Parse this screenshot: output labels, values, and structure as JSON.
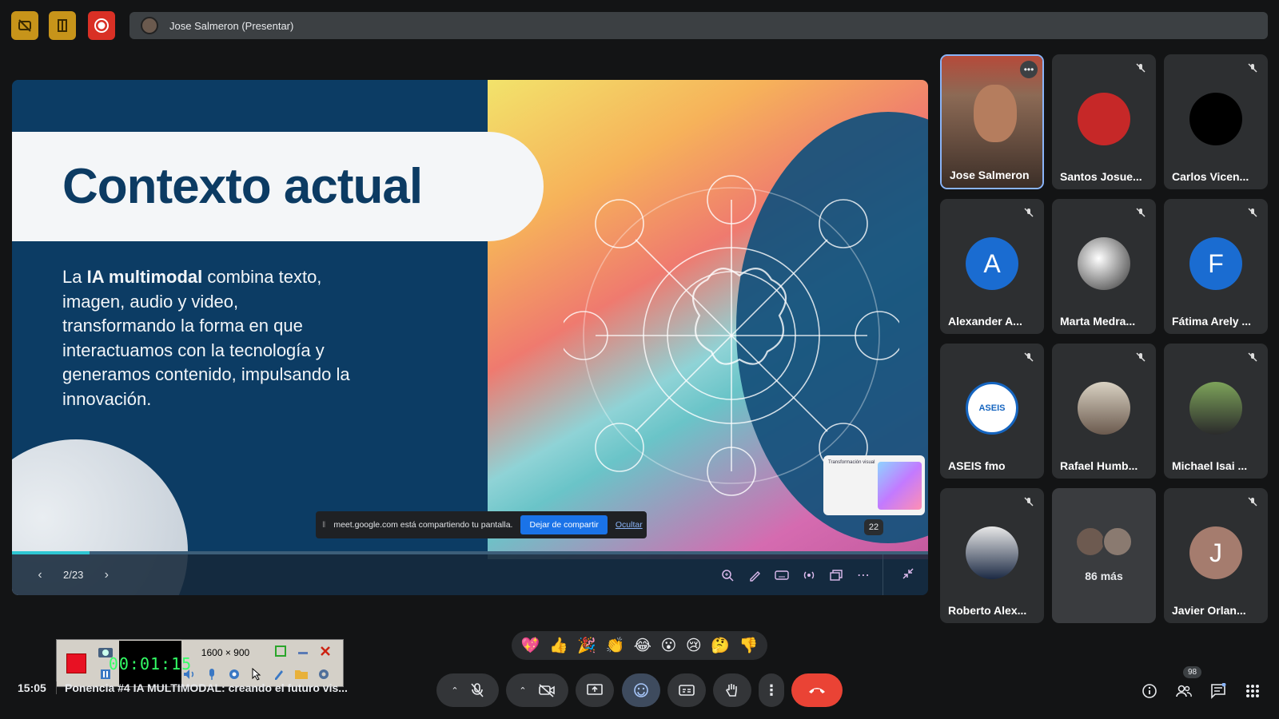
{
  "top_bar": {
    "presenter_label": "Jose Salmeron (Presentar)"
  },
  "slide": {
    "title": "Contexto actual",
    "body_prefix": "La ",
    "body_bold": "IA multimodal",
    "body_rest": " combina texto, imagen, audio y video, transformando la forma en que interactuamos con la tecnología y generamos contenido, impulsando la innovación.",
    "thumbnail_title": "Transformación visual",
    "thumbnail_badge": "22",
    "page_indicator": "2/23",
    "progress_fraction": 0.085
  },
  "share_notice": {
    "text": "meet.google.com está compartiendo tu pantalla.",
    "stop_label": "Dejar de compartir",
    "hide_label": "Ocultar"
  },
  "participants": [
    {
      "name": "Jose Salmeron"
    },
    {
      "name": "Santos Josue..."
    },
    {
      "name": "Carlos Vicen..."
    },
    {
      "name": "Alexander A...",
      "initial": "A",
      "color": "#1a73e8"
    },
    {
      "name": "Marta Medra..."
    },
    {
      "name": "Fátima Arely ...",
      "initial": "F",
      "color": "#1a73e8"
    },
    {
      "name": "ASEIS fmo"
    },
    {
      "name": "Rafael Humb..."
    },
    {
      "name": "Michael Isai ..."
    },
    {
      "name": "Roberto Alex..."
    },
    {
      "name": "86 más"
    },
    {
      "name": "Javier Orlan...",
      "initial": "J",
      "color": "#a57c6e"
    }
  ],
  "recorder": {
    "timer": "00:01:15",
    "dimensions": "1600 × 900"
  },
  "bottom": {
    "time": "15:05",
    "meeting_title": "Ponencia #4 IA MULTIMODAL: creando el futuro vis...",
    "reactions": [
      "💖",
      "👍",
      "🎉",
      "👏",
      "😂",
      "😮",
      "😢",
      "🤔",
      "👎"
    ],
    "participant_count": "98"
  }
}
